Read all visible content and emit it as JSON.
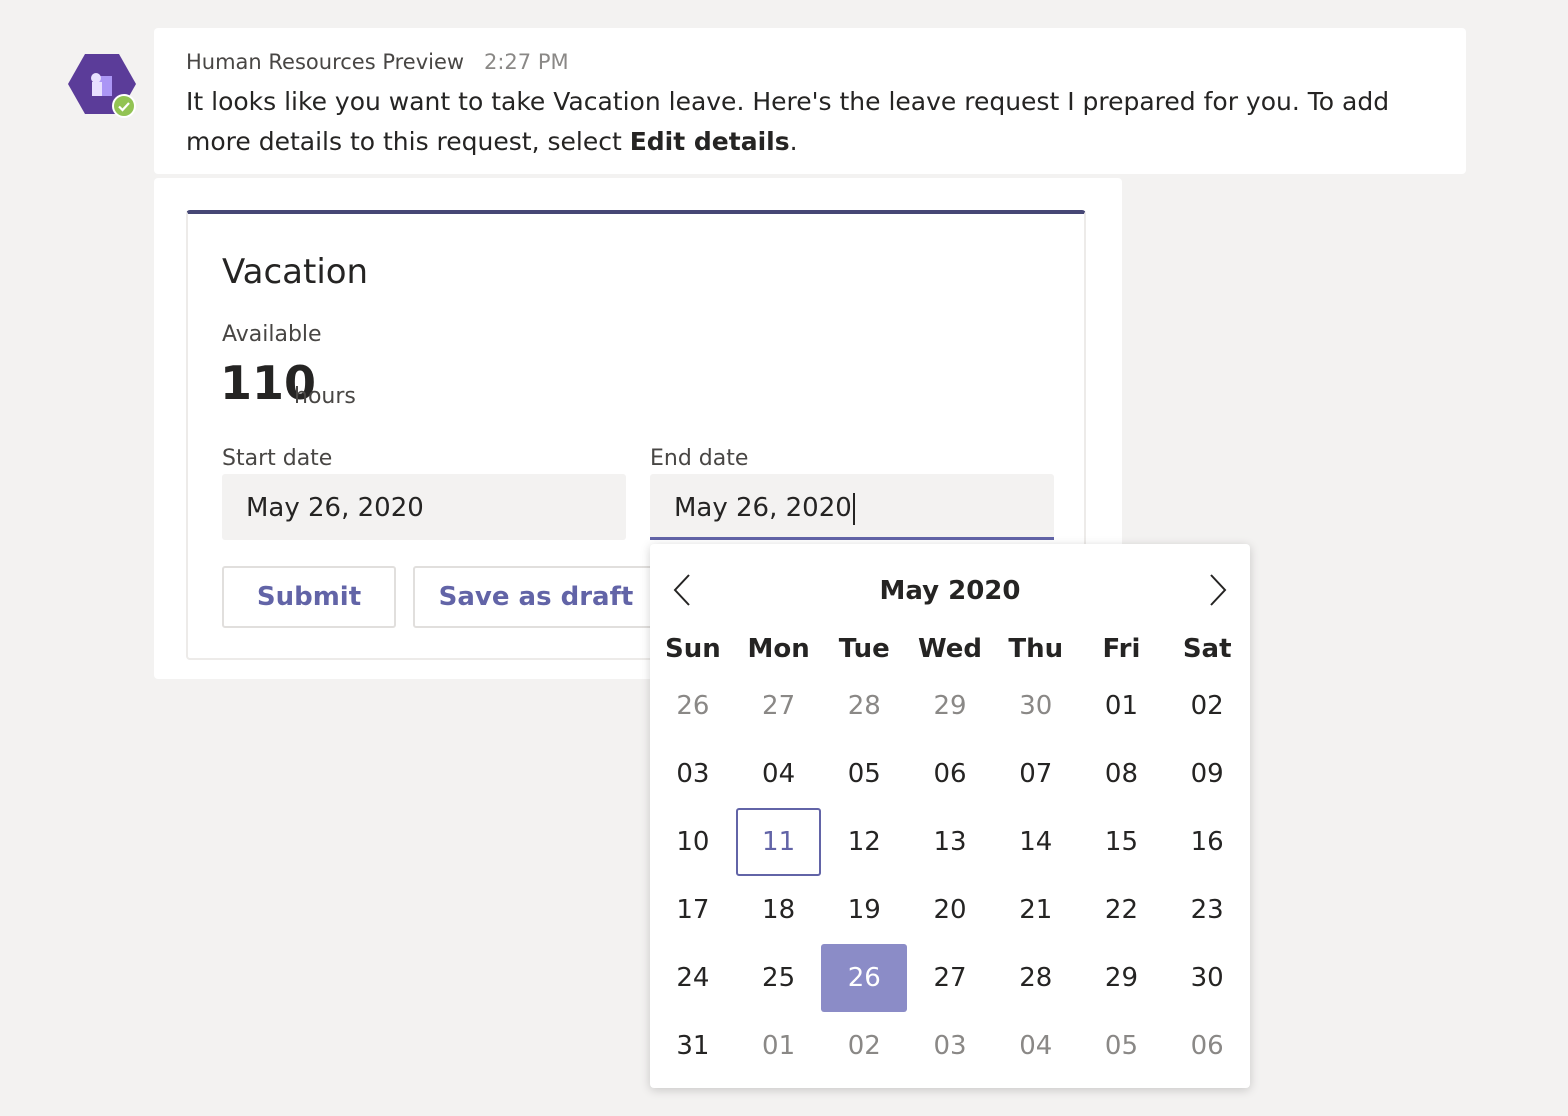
{
  "message": {
    "sender": "Human Resources Preview",
    "time": "2:27 PM",
    "text_part1": "It looks like you want to take Vacation leave. Here's the leave request I prepared for you. To add more details to this request, select ",
    "text_bold": "Edit details",
    "text_part2": "."
  },
  "card": {
    "title": "Vacation",
    "available_label": "Available",
    "hours_value": "110",
    "hours_unit": "hours",
    "start_label": "Start date",
    "start_value": "May 26, 2020",
    "end_label": "End date",
    "end_value": "May 26, 2020",
    "submit_label": "Submit",
    "draft_label": "Save as draft"
  },
  "calendar": {
    "title": "May 2020",
    "weekdays": [
      "Sun",
      "Mon",
      "Tue",
      "Wed",
      "Thu",
      "Fri",
      "Sat"
    ],
    "today": "11",
    "selected": "26",
    "weeks": [
      [
        {
          "d": "26",
          "o": true
        },
        {
          "d": "27",
          "o": true
        },
        {
          "d": "28",
          "o": true
        },
        {
          "d": "29",
          "o": true
        },
        {
          "d": "30",
          "o": true
        },
        {
          "d": "01",
          "o": false
        },
        {
          "d": "02",
          "o": false
        }
      ],
      [
        {
          "d": "03",
          "o": false
        },
        {
          "d": "04",
          "o": false
        },
        {
          "d": "05",
          "o": false
        },
        {
          "d": "06",
          "o": false
        },
        {
          "d": "07",
          "o": false
        },
        {
          "d": "08",
          "o": false
        },
        {
          "d": "09",
          "o": false
        }
      ],
      [
        {
          "d": "10",
          "o": false
        },
        {
          "d": "11",
          "o": false,
          "today": true
        },
        {
          "d": "12",
          "o": false
        },
        {
          "d": "13",
          "o": false
        },
        {
          "d": "14",
          "o": false
        },
        {
          "d": "15",
          "o": false
        },
        {
          "d": "16",
          "o": false
        }
      ],
      [
        {
          "d": "17",
          "o": false
        },
        {
          "d": "18",
          "o": false
        },
        {
          "d": "19",
          "o": false
        },
        {
          "d": "20",
          "o": false
        },
        {
          "d": "21",
          "o": false
        },
        {
          "d": "22",
          "o": false
        },
        {
          "d": "23",
          "o": false
        }
      ],
      [
        {
          "d": "24",
          "o": false
        },
        {
          "d": "25",
          "o": false
        },
        {
          "d": "26",
          "o": false,
          "selected": true
        },
        {
          "d": "27",
          "o": false
        },
        {
          "d": "28",
          "o": false
        },
        {
          "d": "29",
          "o": false
        },
        {
          "d": "30",
          "o": false
        }
      ],
      [
        {
          "d": "31",
          "o": false
        },
        {
          "d": "01",
          "o": true
        },
        {
          "d": "02",
          "o": true
        },
        {
          "d": "03",
          "o": true
        },
        {
          "d": "04",
          "o": true
        },
        {
          "d": "05",
          "o": true
        },
        {
          "d": "06",
          "o": true
        }
      ]
    ]
  },
  "icons": {
    "avatar": "hr-app-icon",
    "presence": "available-check-icon",
    "prev": "chevron-left-icon",
    "next": "chevron-right-icon"
  },
  "colors": {
    "accent": "#6264a7",
    "avatar": "#5b3c99",
    "presence": "#92c353",
    "selected_day": "#8b8cc7",
    "card_border": "#464775"
  }
}
